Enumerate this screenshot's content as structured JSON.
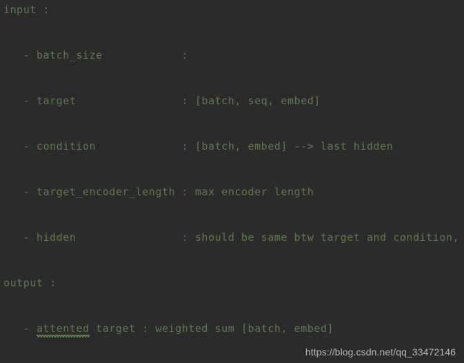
{
  "editor": {
    "background_color": "#2b2b2b",
    "text_color": "#5d7a4f",
    "lines": [
      {
        "text": "input :"
      },
      {
        "text": "   - batch_size            :"
      },
      {
        "text": "   - target                : [batch, seq, embed]"
      },
      {
        "text": "   - condition             : [batch, embed] --> last hidden"
      },
      {
        "text": "   - target_encoder_length : max encoder length"
      },
      {
        "text": "   - hidden                : should be same btw target and condition, oth"
      },
      {
        "text": "output :"
      }
    ],
    "output_line": {
      "prefix": "   - ",
      "misspelled_word": "attented",
      "suffix": " target : weighted sum [batch, embed]"
    }
  },
  "watermark": {
    "text": "https://blog.csdn.net/qq_33472146",
    "color": "#b9b9b9"
  }
}
